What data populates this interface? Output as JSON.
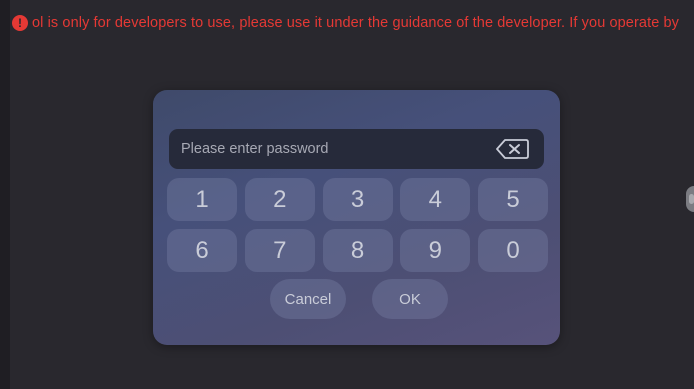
{
  "warning": {
    "icon": "alert-circle-icon",
    "text": "ol is only for developers to use, please use it under the guidance of the developer. If you operate by",
    "color": "#e53935"
  },
  "password_dialog": {
    "input": {
      "value": "",
      "placeholder": "Please enter password"
    },
    "backspace_icon": "backspace-icon",
    "keys": {
      "row1": [
        "1",
        "2",
        "3",
        "4",
        "5"
      ],
      "row2": [
        "6",
        "7",
        "8",
        "9",
        "0"
      ]
    },
    "cancel_label": "Cancel",
    "ok_label": "OK"
  },
  "colors": {
    "background": "#29282e",
    "dialog": "#46507a",
    "field": "#262a3a"
  }
}
